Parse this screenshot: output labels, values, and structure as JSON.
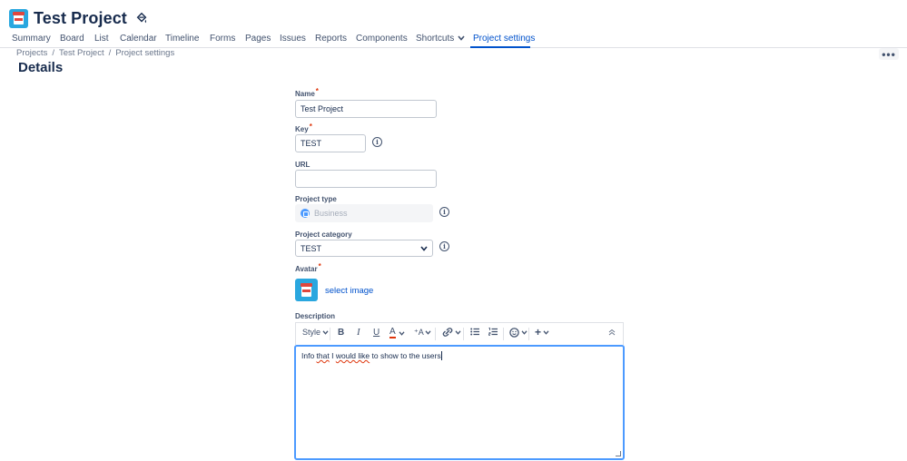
{
  "project": {
    "title": "Test Project"
  },
  "nav": {
    "tabs": [
      {
        "label": "Summary"
      },
      {
        "label": "Board"
      },
      {
        "label": "List"
      },
      {
        "label": "Calendar"
      },
      {
        "label": "Timeline"
      },
      {
        "label": "Forms"
      },
      {
        "label": "Pages"
      },
      {
        "label": "Issues"
      },
      {
        "label": "Reports"
      },
      {
        "label": "Components"
      },
      {
        "label": "Shortcuts"
      },
      {
        "label": "Project settings"
      }
    ]
  },
  "breadcrumb": {
    "items": [
      "Projects",
      "Test Project",
      "Project settings"
    ]
  },
  "page": {
    "title": "Details",
    "more_label": "•••"
  },
  "form": {
    "name": {
      "label": "Name",
      "value": "Test Project"
    },
    "key": {
      "label": "Key",
      "value": "TEST"
    },
    "url": {
      "label": "URL",
      "value": ""
    },
    "project_type": {
      "label": "Project type",
      "value": "Business"
    },
    "project_category": {
      "label": "Project category",
      "value": "TEST"
    },
    "avatar": {
      "label": "Avatar",
      "link": "select image"
    },
    "description": {
      "label": "Description",
      "toolbar": {
        "style": "Style"
      },
      "text_parts": [
        "Info ",
        "that",
        " I ",
        "would like",
        " to show to the users"
      ]
    }
  },
  "colors": {
    "accent": "#0052cc",
    "focus": "#4c9aff",
    "avatar_bg": "#2aa7df",
    "required": "#de350b"
  }
}
